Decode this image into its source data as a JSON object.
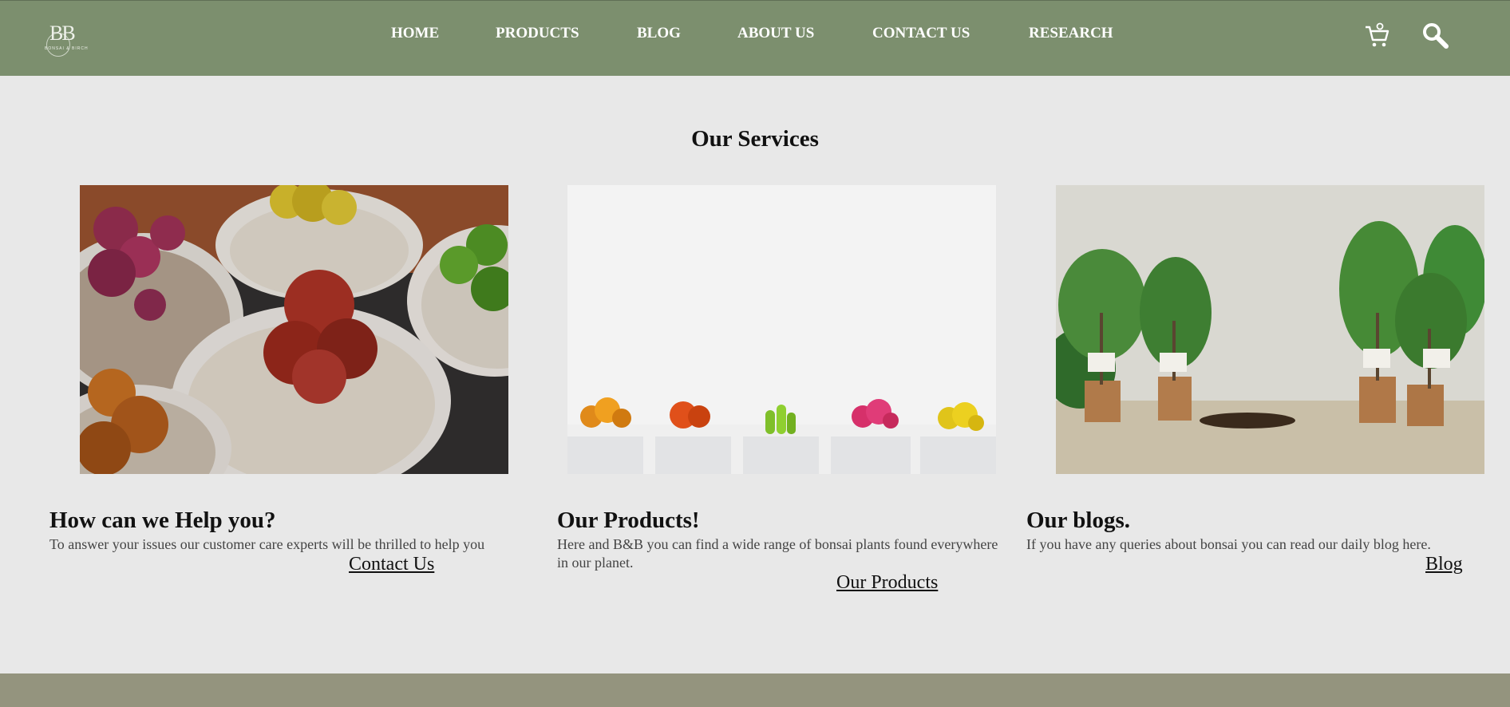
{
  "header": {
    "logo_text": "BB",
    "logo_subtext": "BONSAI & BIRCH",
    "nav": [
      "HOME",
      "PRODUCTS",
      "BLOG",
      "ABOUT US",
      "CONTACT US",
      "RESEARCH"
    ],
    "cart_icon": "cart-icon",
    "search_icon": "search-icon"
  },
  "main": {
    "title": "Our Services",
    "cards": [
      {
        "image": "colorful-cacti-pots-photo",
        "heading": "How can we Help you?",
        "text": "To answer your issues our customer care experts will be thrilled to help you",
        "link": "Contact Us"
      },
      {
        "image": "cacti-row-white-pots-photo",
        "heading": "Our Products!",
        "text": "Here and B&B you can find a wide range of bonsai plants found everywhere in our planet.",
        "link": "Our Products"
      },
      {
        "image": "potted-trees-on-table-photo",
        "heading": "Our blogs.",
        "text": "If you have any queries about bonsai you can read our daily blog here.",
        "link": "Blog"
      }
    ]
  },
  "colors": {
    "header_bg": "#7c8f6e",
    "page_bg": "#e8e8e8",
    "footer_bg": "#94947e"
  }
}
